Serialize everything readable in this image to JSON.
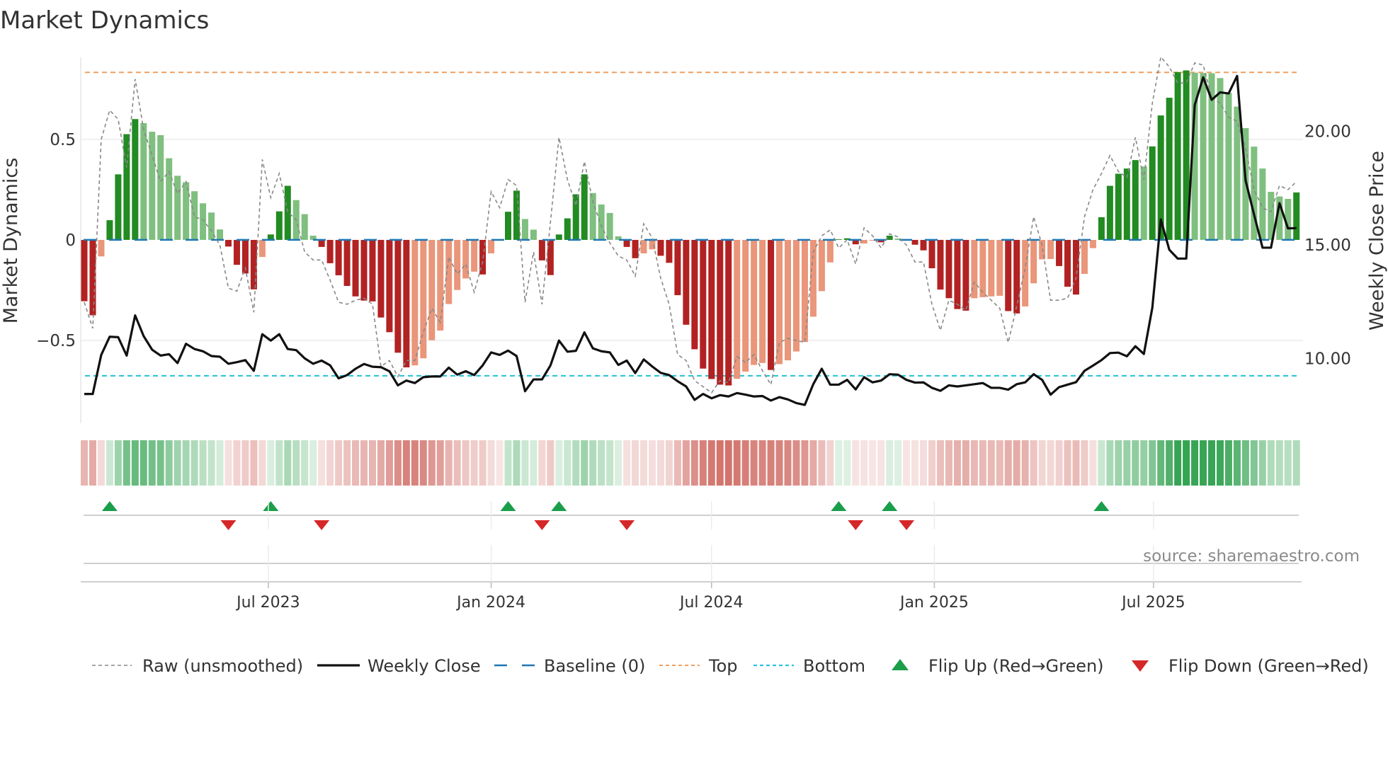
{
  "title": "Market Dynamics",
  "source": "source: sharemaestro.com",
  "colors": {
    "rising_positive": "#228b22",
    "falling_positive": "#7fbf7f",
    "falling_negative": "#b22222",
    "rising_negative": "#e9967a",
    "raw": "#888888",
    "close": "#111111",
    "baseline": "#1f77b4",
    "top": "#f0a060",
    "bottom": "#2ec4d6",
    "flip_up": "#1a9e4a",
    "flip_down": "#d62728"
  },
  "chart_data": {
    "type": "bar",
    "title": "Market Dynamics",
    "ylabel": "Market Dynamics",
    "y2label": "Weekly Close Price",
    "x_start": "2023-01-30",
    "x_step_days": 7,
    "ylim": [
      -0.912,
      0.908
    ],
    "y2lim": [
      7.15,
      23.26
    ],
    "yticks": [
      {
        "value": 0.5,
        "label": "0.5"
      },
      {
        "value": 0,
        "label": "0"
      },
      {
        "value": -0.5,
        "label": "−0.5"
      }
    ],
    "y2ticks": [
      {
        "value": 20,
        "label": "20.00"
      },
      {
        "value": 15,
        "label": "15.00"
      },
      {
        "value": 10,
        "label": "10.00"
      }
    ],
    "xticks": [
      {
        "date": "2023-07-01",
        "label": "Jul 2023"
      },
      {
        "date": "2024-01-01",
        "label": "Jan 2024"
      },
      {
        "date": "2024-07-01",
        "label": "Jul 2024"
      },
      {
        "date": "2025-01-01",
        "label": "Jan 2025"
      },
      {
        "date": "2025-07-01",
        "label": "Jul 2025"
      }
    ],
    "top_level": 0.833,
    "bottom_level": -0.676,
    "baseline": 0,
    "grid": true,
    "legend_placement": "bottom",
    "legend": [
      {
        "key": "raw",
        "label": "Raw (unsmoothed)"
      },
      {
        "key": "close",
        "label": "Weekly Close"
      },
      {
        "key": "baseline",
        "label": "Baseline (0)"
      },
      {
        "key": "top",
        "label": "Top"
      },
      {
        "key": "bottom",
        "label": "Bottom"
      },
      {
        "key": "flip_up",
        "label": "Flip Up (Red→Green)"
      },
      {
        "key": "flip_down",
        "label": "Flip Down (Green→Red)"
      }
    ],
    "series": [
      {
        "name": "Market Dynamics",
        "values": [
          -0.305,
          -0.375,
          -0.082,
          0.098,
          0.326,
          0.526,
          0.601,
          0.581,
          0.538,
          0.521,
          0.406,
          0.319,
          0.287,
          0.242,
          0.182,
          0.136,
          0.052,
          -0.033,
          -0.124,
          -0.167,
          -0.246,
          -0.085,
          0.027,
          0.142,
          0.269,
          0.198,
          0.128,
          0.021,
          -0.035,
          -0.116,
          -0.176,
          -0.229,
          -0.281,
          -0.302,
          -0.306,
          -0.386,
          -0.459,
          -0.561,
          -0.634,
          -0.624,
          -0.589,
          -0.499,
          -0.451,
          -0.319,
          -0.249,
          -0.192,
          -0.158,
          -0.172,
          -0.067,
          -0.004,
          0.14,
          0.245,
          0.104,
          0.051,
          -0.102,
          -0.175,
          0.027,
          0.107,
          0.227,
          0.326,
          0.233,
          0.176,
          0.134,
          0.018,
          -0.035,
          -0.091,
          -0.067,
          -0.047,
          -0.079,
          -0.114,
          -0.275,
          -0.422,
          -0.544,
          -0.64,
          -0.692,
          -0.72,
          -0.724,
          -0.691,
          -0.655,
          -0.622,
          -0.612,
          -0.647,
          -0.618,
          -0.599,
          -0.555,
          -0.508,
          -0.382,
          -0.255,
          -0.112,
          0.003,
          0.008,
          -0.022,
          -0.018,
          -0.004,
          -0.012,
          0.021,
          0.007,
          -0.004,
          -0.024,
          -0.052,
          -0.141,
          -0.247,
          -0.29,
          -0.344,
          -0.352,
          -0.29,
          -0.285,
          -0.281,
          -0.278,
          -0.354,
          -0.366,
          -0.331,
          -0.216,
          -0.097,
          -0.095,
          -0.13,
          -0.233,
          -0.272,
          -0.169,
          -0.041,
          0.113,
          0.269,
          0.329,
          0.355,
          0.397,
          0.365,
          0.465,
          0.619,
          0.707,
          0.835,
          0.843,
          0.832,
          0.83,
          0.829,
          0.805,
          0.732,
          0.663,
          0.556,
          0.464,
          0.355,
          0.239,
          0.216,
          0.204,
          0.236
        ]
      },
      {
        "name": "Raw (unsmoothed)",
        "values": [
          -0.31,
          -0.44,
          0.5,
          0.645,
          0.6,
          0.36,
          0.8,
          0.55,
          0.42,
          0.29,
          0.34,
          0.23,
          0.29,
          0.115,
          0.1,
          0.045,
          -0.026,
          -0.24,
          -0.255,
          -0.14,
          -0.36,
          0.4,
          0.21,
          0.33,
          0.14,
          0.1,
          -0.06,
          -0.1,
          -0.1,
          -0.2,
          -0.31,
          -0.32,
          -0.3,
          -0.29,
          -0.32,
          -0.63,
          -0.6,
          -0.68,
          -0.6,
          -0.6,
          -0.46,
          -0.34,
          -0.41,
          -0.085,
          -0.17,
          -0.12,
          -0.26,
          -0.11,
          0.24,
          0.16,
          0.3,
          0.27,
          -0.31,
          -0.06,
          -0.32,
          0.09,
          0.51,
          0.3,
          0.17,
          0.39,
          0.19,
          0.07,
          -0.015,
          -0.08,
          -0.1,
          -0.18,
          0.08,
          0.01,
          -0.19,
          -0.32,
          -0.57,
          -0.6,
          -0.7,
          -0.73,
          -0.76,
          -0.7,
          -0.71,
          -0.58,
          -0.61,
          -0.57,
          -0.65,
          -0.72,
          -0.51,
          -0.49,
          -0.5,
          -0.51,
          -0.06,
          0.02,
          0.05,
          -0.04,
          0.0,
          -0.12,
          0.06,
          0.02,
          -0.04,
          0.03,
          0.015,
          -0.026,
          -0.11,
          -0.11,
          -0.32,
          -0.45,
          -0.3,
          -0.32,
          -0.35,
          -0.21,
          -0.26,
          -0.3,
          -0.34,
          -0.51,
          -0.33,
          -0.14,
          0.115,
          -0.026,
          -0.3,
          -0.3,
          -0.29,
          -0.19,
          0.116,
          0.25,
          0.33,
          0.42,
          0.34,
          0.31,
          0.51,
          0.3,
          0.68,
          0.91,
          0.86,
          0.78,
          0.78,
          0.88,
          0.87,
          0.71,
          0.68,
          0.61,
          0.59,
          0.455,
          0.25,
          0.16,
          0.14,
          0.27,
          0.25,
          0.29
        ]
      },
      {
        "name": "Weekly Close",
        "axis": "right",
        "values": [
          8.44,
          8.44,
          10.16,
          10.96,
          10.94,
          10.13,
          11.9,
          10.99,
          10.39,
          10.13,
          10.19,
          9.8,
          10.65,
          10.42,
          10.32,
          10.11,
          10.08,
          9.77,
          9.84,
          9.93,
          9.46,
          11.07,
          10.79,
          11.07,
          10.42,
          10.37,
          10.01,
          9.77,
          9.91,
          9.7,
          9.13,
          9.27,
          9.55,
          9.76,
          9.64,
          9.62,
          9.44,
          8.82,
          9.03,
          8.92,
          9.18,
          9.21,
          9.21,
          9.6,
          9.29,
          9.44,
          9.27,
          9.7,
          10.27,
          10.16,
          10.35,
          10.11,
          8.56,
          9.08,
          9.08,
          9.7,
          10.79,
          10.3,
          10.34,
          11.15,
          10.45,
          10.32,
          10.27,
          9.72,
          9.91,
          9.36,
          9.96,
          9.65,
          9.37,
          9.27,
          9.0,
          8.77,
          8.18,
          8.44,
          8.25,
          8.39,
          8.33,
          8.48,
          8.41,
          8.33,
          8.35,
          8.15,
          8.3,
          8.2,
          8.04,
          7.96,
          8.87,
          9.55,
          8.85,
          8.85,
          9.06,
          8.64,
          9.18,
          8.95,
          9.03,
          9.31,
          9.29,
          9.06,
          8.94,
          8.95,
          8.71,
          8.58,
          8.82,
          8.77,
          8.82,
          8.87,
          8.92,
          8.71,
          8.71,
          8.63,
          8.87,
          8.95,
          9.31,
          9.06,
          8.41,
          8.74,
          8.85,
          8.96,
          9.46,
          9.69,
          9.93,
          10.24,
          10.26,
          10.1,
          10.54,
          10.2,
          12.24,
          16.12,
          14.79,
          14.4,
          14.4,
          21.16,
          22.38,
          21.39,
          21.72,
          21.67,
          22.44,
          17.84,
          16.34,
          14.88,
          14.88,
          16.84,
          15.73,
          15.74
        ]
      }
    ]
  }
}
